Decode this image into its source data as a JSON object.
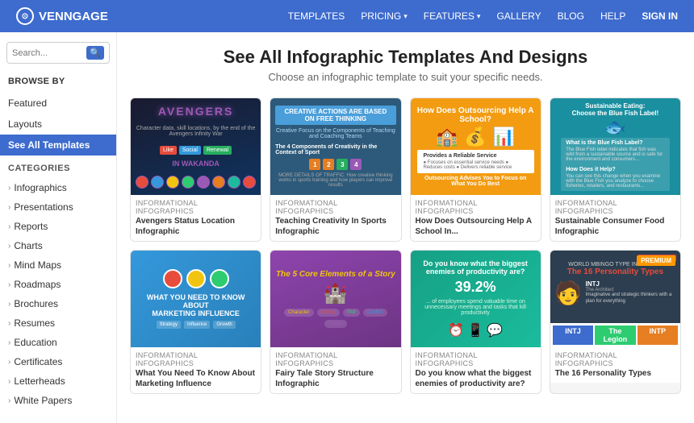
{
  "nav": {
    "logo_text": "VENNGAGE",
    "links": [
      {
        "label": "TEMPLATES",
        "has_dropdown": false
      },
      {
        "label": "PRICING",
        "has_dropdown": true
      },
      {
        "label": "FEATURES",
        "has_dropdown": true
      },
      {
        "label": "GALLERY",
        "has_dropdown": false
      },
      {
        "label": "BLOG",
        "has_dropdown": false
      },
      {
        "label": "HELP",
        "has_dropdown": false
      },
      {
        "label": "SIGN IN",
        "has_dropdown": false
      }
    ]
  },
  "sidebar": {
    "search_placeholder": "Search...",
    "browse_by_label": "BROWSE BY",
    "browse_items": [
      {
        "label": "Featured"
      },
      {
        "label": "Layouts"
      },
      {
        "label": "See All Templates",
        "active": true
      }
    ],
    "categories_label": "CATEGORIES",
    "categories": [
      {
        "label": "Infographics"
      },
      {
        "label": "Presentations"
      },
      {
        "label": "Reports"
      },
      {
        "label": "Charts"
      },
      {
        "label": "Mind Maps"
      },
      {
        "label": "Roadmaps"
      },
      {
        "label": "Brochures"
      },
      {
        "label": "Resumes"
      },
      {
        "label": "Education"
      },
      {
        "label": "Certificates"
      },
      {
        "label": "Letterheads"
      },
      {
        "label": "White Papers"
      }
    ]
  },
  "content": {
    "title": "See All Infographic Templates And Designs",
    "subtitle": "Choose an infographic template to suit your specific needs.",
    "templates": [
      {
        "id": "avengers",
        "category": "Informational Infographics",
        "title": "Avengers Status Location Infographic",
        "premium": false
      },
      {
        "id": "creativity",
        "category": "Informational Infographics",
        "title": "Teaching Creativity In Sports Infographic",
        "premium": false
      },
      {
        "id": "outsourcing",
        "category": "Informational Infographics",
        "title": "How Does Outsourcing Help A School In...",
        "premium": false
      },
      {
        "id": "sustainable",
        "category": "Informational Infographics",
        "title": "Sustainable Consumer Food Infographic",
        "premium": false
      },
      {
        "id": "marketing",
        "category": "Informational Infographics",
        "title": "What You Need To Know About Marketing Influence",
        "premium": false
      },
      {
        "id": "fairytale",
        "category": "Informational Infographics",
        "title": "Fairy Tale Story Structure Infographic",
        "premium": false
      },
      {
        "id": "productivity",
        "category": "Informational Infographics",
        "title": "Do you know what the biggest enemies of productivity are?",
        "premium": false
      },
      {
        "id": "personality",
        "category": "Informational Infographics",
        "title": "The 16 Personality Types",
        "premium": true
      }
    ]
  }
}
